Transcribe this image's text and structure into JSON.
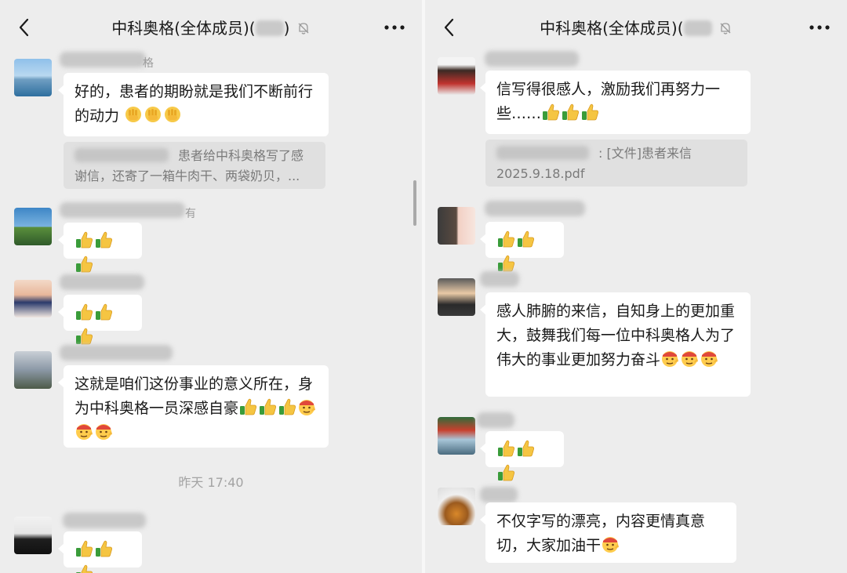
{
  "left": {
    "title": "中科奥格(全体成员)(",
    "messages": [
      {
        "text": "好的，患者的期盼就是我们不断前行的动力",
        "emoji": "fist-emoji x3",
        "name_suffix": "格",
        "quote": "患者给中科奥格写了感谢信，还寄了一箱牛肉干、两袋奶贝，..."
      },
      {
        "emoji": "thumbs-up x3",
        "name_suffix": "有"
      },
      {
        "emoji": "thumbs-up x3"
      },
      {
        "text": "这就是咱们这份事业的意义所在，身为中科奥格一员深感自豪",
        "emoji": "thumbs-up x3 + salute-emoji x3"
      },
      {
        "emoji": "thumbs-up x3"
      }
    ],
    "timestamp": "昨天 17:40"
  },
  "right": {
    "title": "中科奥格(全体成员)(",
    "messages": [
      {
        "text": "信写得很感人，激励我们再努力一些……",
        "emoji": "thumbs-up x3",
        "quote": ": [文件]患者来信2025.9.18.pdf"
      },
      {
        "emoji": "thumbs-up x3"
      },
      {
        "text": "感人肺腑的来信，自知身上的更加重大，鼓舞我们每一位中科奥格人为了伟大的事业更加努力奋斗",
        "emoji": "salute-emoji x3"
      },
      {
        "emoji": "thumbs-up x3"
      },
      {
        "text": "不仅字写的漂亮，内容更情真意切，大家加油干",
        "emoji": "salute-emoji x1"
      }
    ]
  },
  "colors": {
    "chat_bg": "#ededed",
    "bubble": "#ffffff",
    "quote_bg": "#e0e0e0"
  },
  "icons": [
    "back-chevron-icon",
    "mute-bell-icon",
    "more-dots-icon"
  ]
}
